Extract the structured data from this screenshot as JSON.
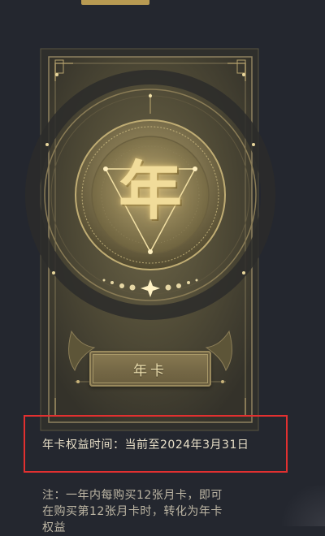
{
  "card": {
    "emblem_glyph": "年",
    "button_label": "年卡"
  },
  "benefit": {
    "text": "年卡权益时间：当前至2024年3月31日"
  },
  "note": {
    "lines": [
      "注：一年内每购买12张月卡，即可",
      "在购买第12张月卡时，转化为年卡",
      "权益"
    ]
  },
  "colors": {
    "background": "#24272f",
    "gold": "#c8b37a",
    "highlight": "#e23030"
  }
}
